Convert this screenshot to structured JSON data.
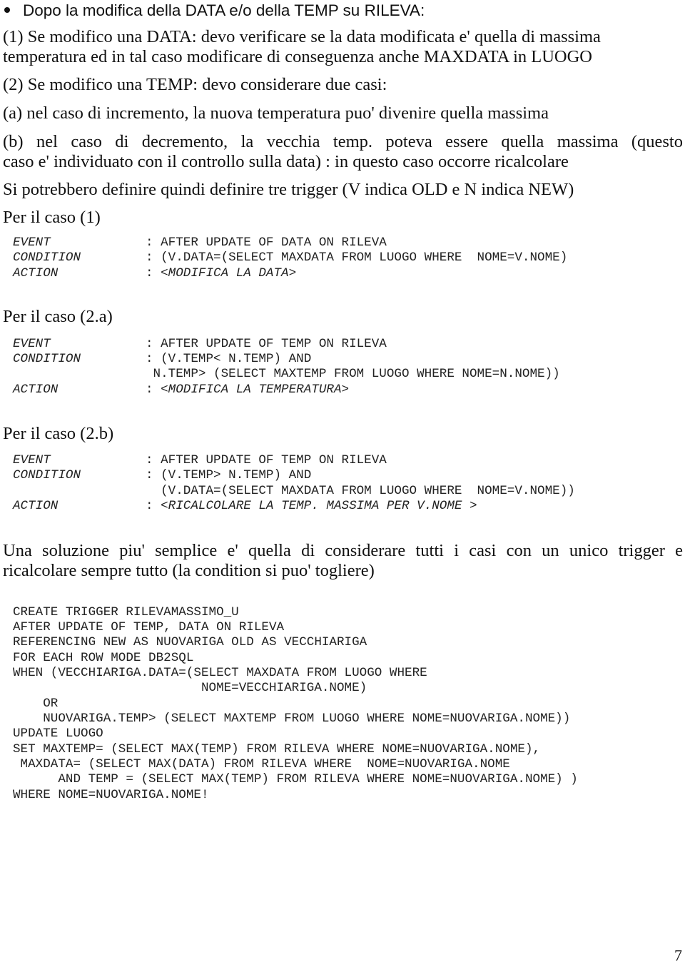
{
  "bullet": {
    "text": "Dopo la modifica della DATA e/o della TEMP su RILEVA:"
  },
  "paragraphs": {
    "p1_line1": "(1) Se modifico una DATA:  devo verificare se la data modificata e' quella di massima",
    "p1_line2": "temperatura ed in tal caso modificare di conseguenza anche MAXDATA in LUOGO",
    "p2": "(2) Se modifico una TEMP: devo considerare due casi:",
    "p2a": " (a) nel caso di incremento, la nuova temperatura puo' divenire quella massima",
    "p2b_line1": " (b) nel caso di decremento, la vecchia temp. poteva essere quella massima (questo",
    "p2b_line2": "caso e' individuato con il controllo sulla data) : in questo caso occorre ricalcolare",
    "p3": "Si potrebbero definire quindi definire tre trigger  (V indica OLD e N indica NEW)"
  },
  "cases": [
    {
      "heading": "Per il caso (1)",
      "event_label": "EVENT",
      "event_value": ": AFTER UPDATE OF DATA ON RILEVA",
      "condition_label": "CONDITION",
      "condition_lines": [
        ": (V.DATA=(SELECT MAXDATA FROM LUOGO WHERE  NOME=V.NOME)"
      ],
      "action_label": "ACTION",
      "action_prefix": ": ",
      "action_value": "<MODIFICA LA DATA>"
    },
    {
      "heading": "Per il caso (2.a)",
      "event_label": "EVENT",
      "event_value": ": AFTER UPDATE OF TEMP ON RILEVA",
      "condition_label": "CONDITION",
      "condition_lines": [
        ": (V.TEMP< N.TEMP) AND",
        " N.TEMP> (SELECT MAXTEMP FROM LUOGO WHERE NOME=N.NOME))"
      ],
      "action_label": "ACTION",
      "action_prefix": ": ",
      "action_value": "<MODIFICA LA TEMPERATURA>"
    },
    {
      "heading": "Per il caso (2.b)",
      "event_label": "EVENT",
      "event_value": ": AFTER UPDATE OF TEMP ON RILEVA",
      "condition_label": "CONDITION",
      "condition_lines": [
        ": (V.TEMP> N.TEMP) AND",
        "  (V.DATA=(SELECT MAXDATA FROM LUOGO WHERE  NOME=V.NOME))"
      ],
      "action_label": "ACTION",
      "action_prefix": ": ",
      "action_value": "<RICALCOLARE LA TEMP. MASSIMA PER V.NOME >"
    }
  ],
  "solution": {
    "line1": "Una soluzione piu' semplice e' quella di considerare tutti i casi con un unico trigger e",
    "line2": "ricalcolare sempre tutto (la condition si puo' togliere)"
  },
  "code": [
    "CREATE TRIGGER RILEVAMASSIMO_U",
    "AFTER UPDATE OF TEMP, DATA ON RILEVA",
    "REFERENCING NEW AS NUOVARIGA OLD AS VECCHIARIGA",
    "FOR EACH ROW MODE DB2SQL",
    "WHEN (VECCHIARIGA.DATA=(SELECT MAXDATA FROM LUOGO WHERE",
    "                         NOME=VECCHIARIGA.NOME)",
    "    OR",
    "    NUOVARIGA.TEMP> (SELECT MAXTEMP FROM LUOGO WHERE NOME=NUOVARIGA.NOME))",
    "UPDATE LUOGO",
    "SET MAXTEMP= (SELECT MAX(TEMP) FROM RILEVA WHERE NOME=NUOVARIGA.NOME),",
    " MAXDATA= (SELECT MAX(DATA) FROM RILEVA WHERE  NOME=NUOVARIGA.NOME",
    "      AND TEMP = (SELECT MAX(TEMP) FROM RILEVA WHERE NOME=NUOVARIGA.NOME) )",
    "WHERE NOME=NUOVARIGA.NOME!"
  ],
  "page_number": "7"
}
